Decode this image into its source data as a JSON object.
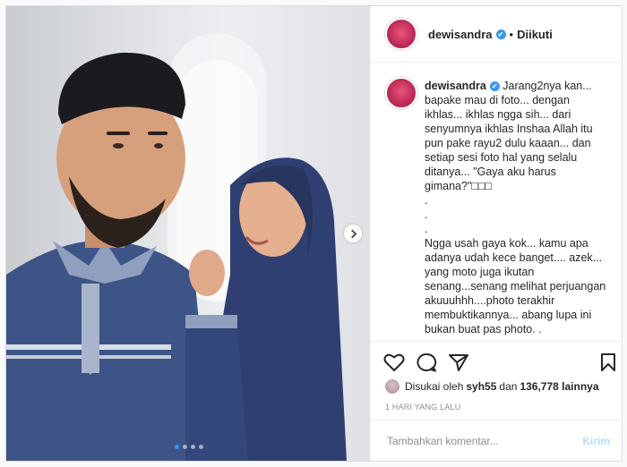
{
  "post": {
    "username": "dewisandra",
    "verified_mark": "✔",
    "separator": "•",
    "follow_status": "Diikuti",
    "caption": "Jarang2nya kan... bapake mau di foto... dengan ikhlas... ikhlas ngga sih... dari senyumnya ikhlas Inshaa Allah itu pun pake rayu2 dulu kaaan... dan setiap sesi foto hal yang selalu ditanya... \"Gaya aku harus gimana?\"□□□\n.\n.\n.\nNgga usah gaya kok... kamu apa adanya udah kece banget.... azek... yang moto juga ikutan senang...senang melihat perjuangan akuuuhhh....photo terakhir membuktikannya... abang lupa ini bukan buat pas photo. .\n.\nWearing baju koko and dress syari by",
    "liked_by_prefix": "Disukai oleh",
    "liked_by_user": "syh55",
    "liked_by_and": "dan",
    "like_count": "136,778 lainnya",
    "timestamp": "1 HARI YANG LALU",
    "comment_placeholder": "Tambahkan komentar...",
    "post_button": "Kirim",
    "carousel": {
      "total": 4,
      "active_index": 0
    }
  },
  "icons": {
    "like": "heart-icon",
    "comment": "comment-bubble-icon",
    "share": "paper-plane-icon",
    "save": "bookmark-icon",
    "next": "chevron-right-icon"
  },
  "colors": {
    "verified": "#3897f0",
    "post_button_disabled": "#b2dffc",
    "avatar_brand": "#c22d5b"
  }
}
